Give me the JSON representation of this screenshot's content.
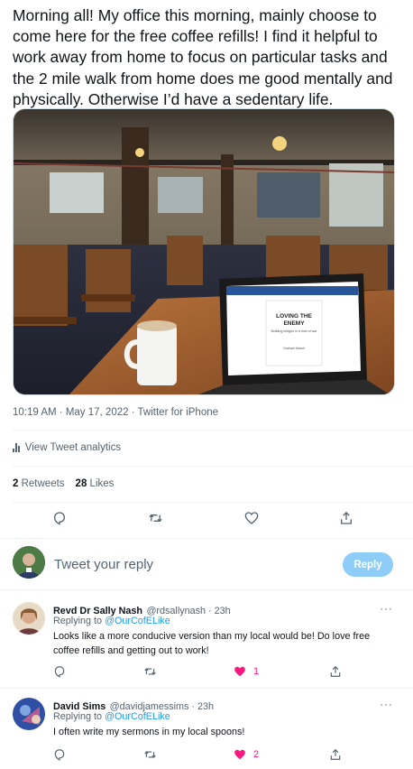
{
  "tweet": {
    "text": "Morning all! My office this morning, mainly choose to come here for the free coffee refills! I find it helpful to work away from home to focus on particular tasks and the 2 mile walk from home does me good mentally and physically. Otherwise I’d have a sedentary life.",
    "time": "10:19 AM",
    "date": "May 17, 2022",
    "source": "Twitter for iPhone",
    "separator": " · ",
    "analytics_label": "View Tweet analytics",
    "retweets_count": "2",
    "retweets_label": "Retweets",
    "likes_count": "28",
    "likes_label": "Likes"
  },
  "photo": {
    "book_title": "LOVING THE ENEMY",
    "book_subtitle": "Building bridges in a time of war",
    "book_author": "Graham Marsh"
  },
  "compose": {
    "placeholder": "Tweet your reply",
    "reply_button": "Reply"
  },
  "replies": [
    {
      "name": "Revd Dr Sally Nash",
      "handle": "@rdsallynash",
      "separator": " · ",
      "time": "23h",
      "replying_prefix": "Replying to ",
      "replying_to": "@OurCofELike",
      "text": "Looks like a more conducive version than my local would be! Do love free coffee refills and getting out to work!",
      "likes": "1",
      "more": "···"
    },
    {
      "name": "David Sims",
      "handle": "@davidjamessims",
      "separator": " · ",
      "time": "23h",
      "replying_prefix": "Replying to ",
      "replying_to": "@OurCofELike",
      "text": "I often write my sermons in my local spoons!",
      "likes": "2",
      "more": "···"
    }
  ],
  "colors": {
    "accent": "#1d9bf0",
    "like": "#f91880",
    "reply_button": "#8ecdf8",
    "secondary_text": "#536471"
  }
}
